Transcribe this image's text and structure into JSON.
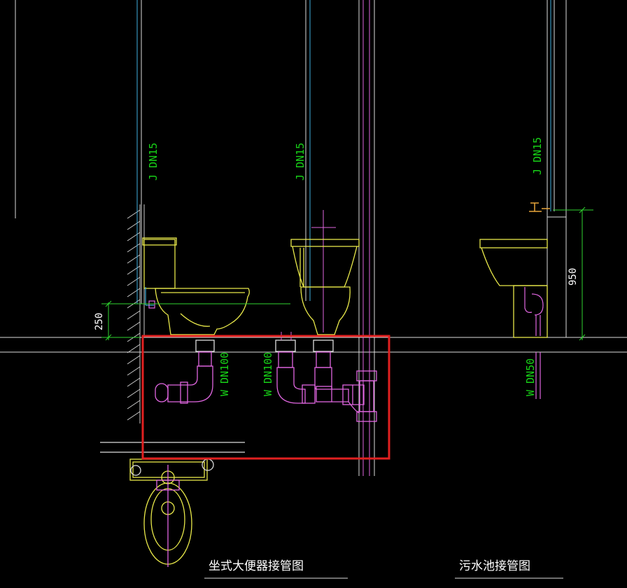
{
  "drawing": {
    "labels": {
      "supply_left": "J  DN15",
      "supply_mid": "J  DN15",
      "supply_right": "J  DN15",
      "drain_left": "W  DN100",
      "drain_mid": "W  DN100",
      "drain_right": "W  DN50",
      "dim_left": "250",
      "dim_right": "950"
    },
    "titles": {
      "toilet": "坐式大便器接管图",
      "mop_sink": "污水池接管图"
    },
    "colors": {
      "background": "#000000",
      "fixture": "#e8e84a",
      "supply_pipe": "#3fb0e0",
      "drain_pipe": "#e066e0",
      "label_green": "#17d117",
      "dimension": "#2fd42f",
      "highlight_box": "#e02020",
      "floor_line": "#ffffff"
    }
  }
}
